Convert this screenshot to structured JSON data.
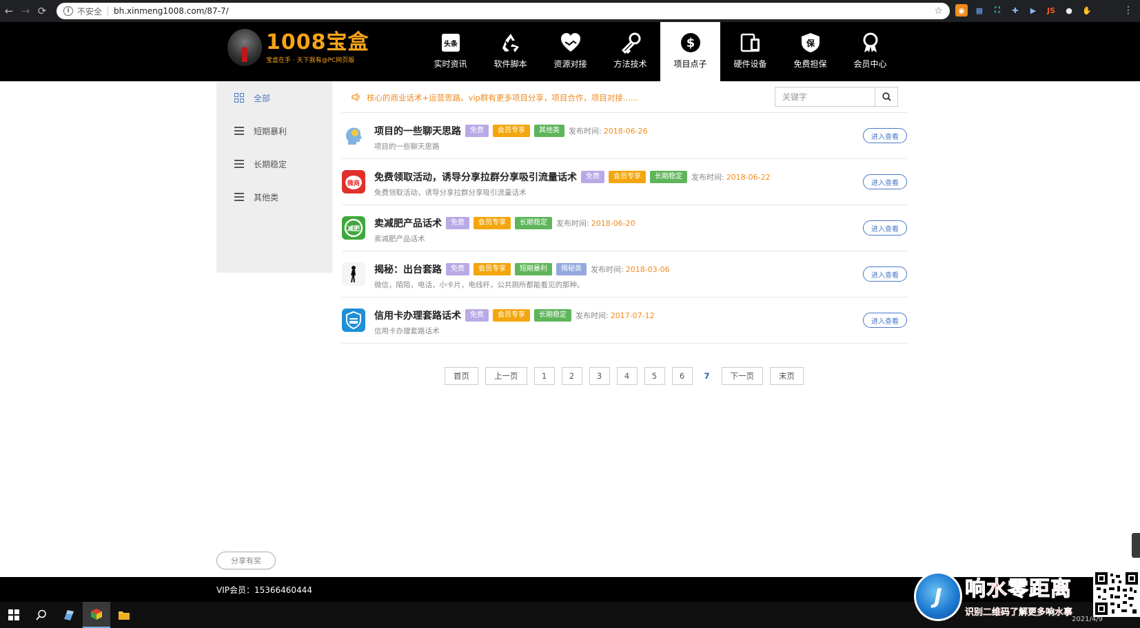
{
  "browser": {
    "security_label": "不安全",
    "url": "bh.xinmeng1008.com/87-7/",
    "info_icon": "info-icon",
    "star_icon": "star-icon"
  },
  "logo": {
    "title": "1008宝盒",
    "slogan": "宝盒在手 · 天下我有@PC网页版"
  },
  "nav": {
    "items": [
      {
        "label": "实时资讯",
        "icon": "news-icon"
      },
      {
        "label": "软件脚本",
        "icon": "recycle-icon"
      },
      {
        "label": "资源对接",
        "icon": "handshake-heart-icon"
      },
      {
        "label": "方法技术",
        "icon": "key-icon"
      },
      {
        "label": "项目点子",
        "icon": "dollar-coin-icon"
      },
      {
        "label": "硬件设备",
        "icon": "devices-icon"
      },
      {
        "label": "免费担保",
        "icon": "shield-guarantee-icon"
      },
      {
        "label": "会员中心",
        "icon": "medal-icon"
      }
    ],
    "active_index": 4,
    "news_badge": "头条",
    "guarantee_badge": "保"
  },
  "sidebar": {
    "items": [
      {
        "label": "全部",
        "icon": "grid-icon"
      },
      {
        "label": "短期暴利",
        "icon": "menu-icon"
      },
      {
        "label": "长期稳定",
        "icon": "menu-icon"
      },
      {
        "label": "其他类",
        "icon": "menu-icon"
      }
    ]
  },
  "notice": {
    "text": "核心的商业话术+运营思路。vip群有更多项目分享，项目合作，项目对接......"
  },
  "search": {
    "placeholder": "关键字"
  },
  "list": {
    "pub_label": "发布时间:",
    "enter_label": "进入查看",
    "items": [
      {
        "title": "项目的一些聊天思路",
        "tags": [
          {
            "text": "免费",
            "kind": "free"
          },
          {
            "text": "会员专享",
            "kind": "member"
          },
          {
            "text": "其他类",
            "kind": "cat"
          }
        ],
        "date": "2018-06-26",
        "desc": "项目的一些聊天思路",
        "thumb": "thinking-head-icon"
      },
      {
        "title": "免费领取活动，诱导分享拉群分享吸引流量话术",
        "tags": [
          {
            "text": "免费",
            "kind": "free"
          },
          {
            "text": "会员专享",
            "kind": "member"
          },
          {
            "text": "长期稳定",
            "kind": "cat"
          }
        ],
        "date": "2018-06-22",
        "desc": "免费领取活动，诱导分享拉群分享吸引流量话术",
        "thumb": "weibo-icon",
        "thumb_text": "微商"
      },
      {
        "title": "卖减肥产品话术",
        "tags": [
          {
            "text": "免费",
            "kind": "free"
          },
          {
            "text": "会员专享",
            "kind": "member"
          },
          {
            "text": "长期稳定",
            "kind": "cat"
          }
        ],
        "date": "2018-06-20",
        "desc": "卖减肥产品话术",
        "thumb": "diet-icon",
        "thumb_text": "减肥"
      },
      {
        "title": "揭秘：出台套路",
        "tags": [
          {
            "text": "免费",
            "kind": "free"
          },
          {
            "text": "会员专享",
            "kind": "member"
          },
          {
            "text": "短期暴利",
            "kind": "cat"
          },
          {
            "text": "揭秘类",
            "kind": "secret"
          }
        ],
        "date": "2018-03-06",
        "desc": "微信，陌陌，电话，小卡片，电线杆，公共厕所都能看见的那种。",
        "thumb": "silhouette-icon"
      },
      {
        "title": "信用卡办理套路话术",
        "tags": [
          {
            "text": "免费",
            "kind": "free"
          },
          {
            "text": "会员专享",
            "kind": "member"
          },
          {
            "text": "长期稳定",
            "kind": "cat"
          }
        ],
        "date": "2017-07-12",
        "desc": "信用卡办理套路话术",
        "thumb": "credit-card-shield-icon"
      }
    ]
  },
  "pagination": {
    "first": "首页",
    "prev": "上一页",
    "pages": [
      "1",
      "2",
      "3",
      "4",
      "5",
      "6"
    ],
    "current": "7",
    "next": "下一页",
    "last": "末页"
  },
  "footer": {
    "share_label": "分享有奖",
    "vip_text": "VIP会员：15366460444"
  },
  "taskbar": {
    "clock": "2021/4/9"
  },
  "watermark": {
    "title": "响水零距离",
    "subtitle": "识别二维码了解更多响水事"
  },
  "colors": {
    "accent_blue": "#4a78c6",
    "orange": "#f08a1e",
    "tag_free": "#b9a9e6",
    "tag_member": "#f3a60e",
    "tag_cat": "#5fb55a",
    "tag_secret": "#93a9dd"
  }
}
